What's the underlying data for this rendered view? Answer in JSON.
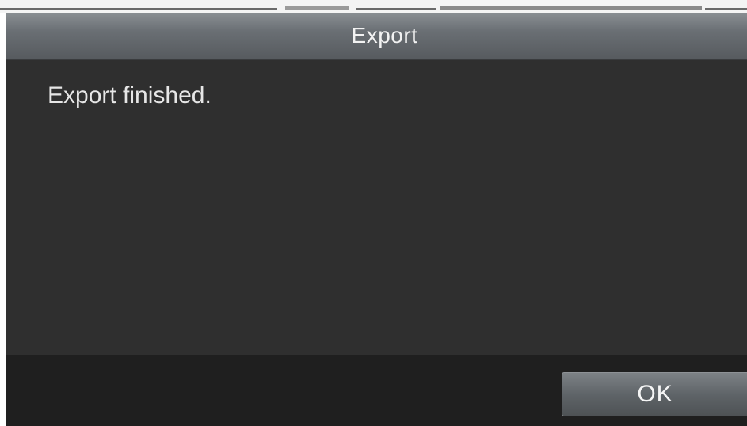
{
  "dialog": {
    "title": "Export",
    "message": "Export finished.",
    "ok_label": "OK"
  }
}
